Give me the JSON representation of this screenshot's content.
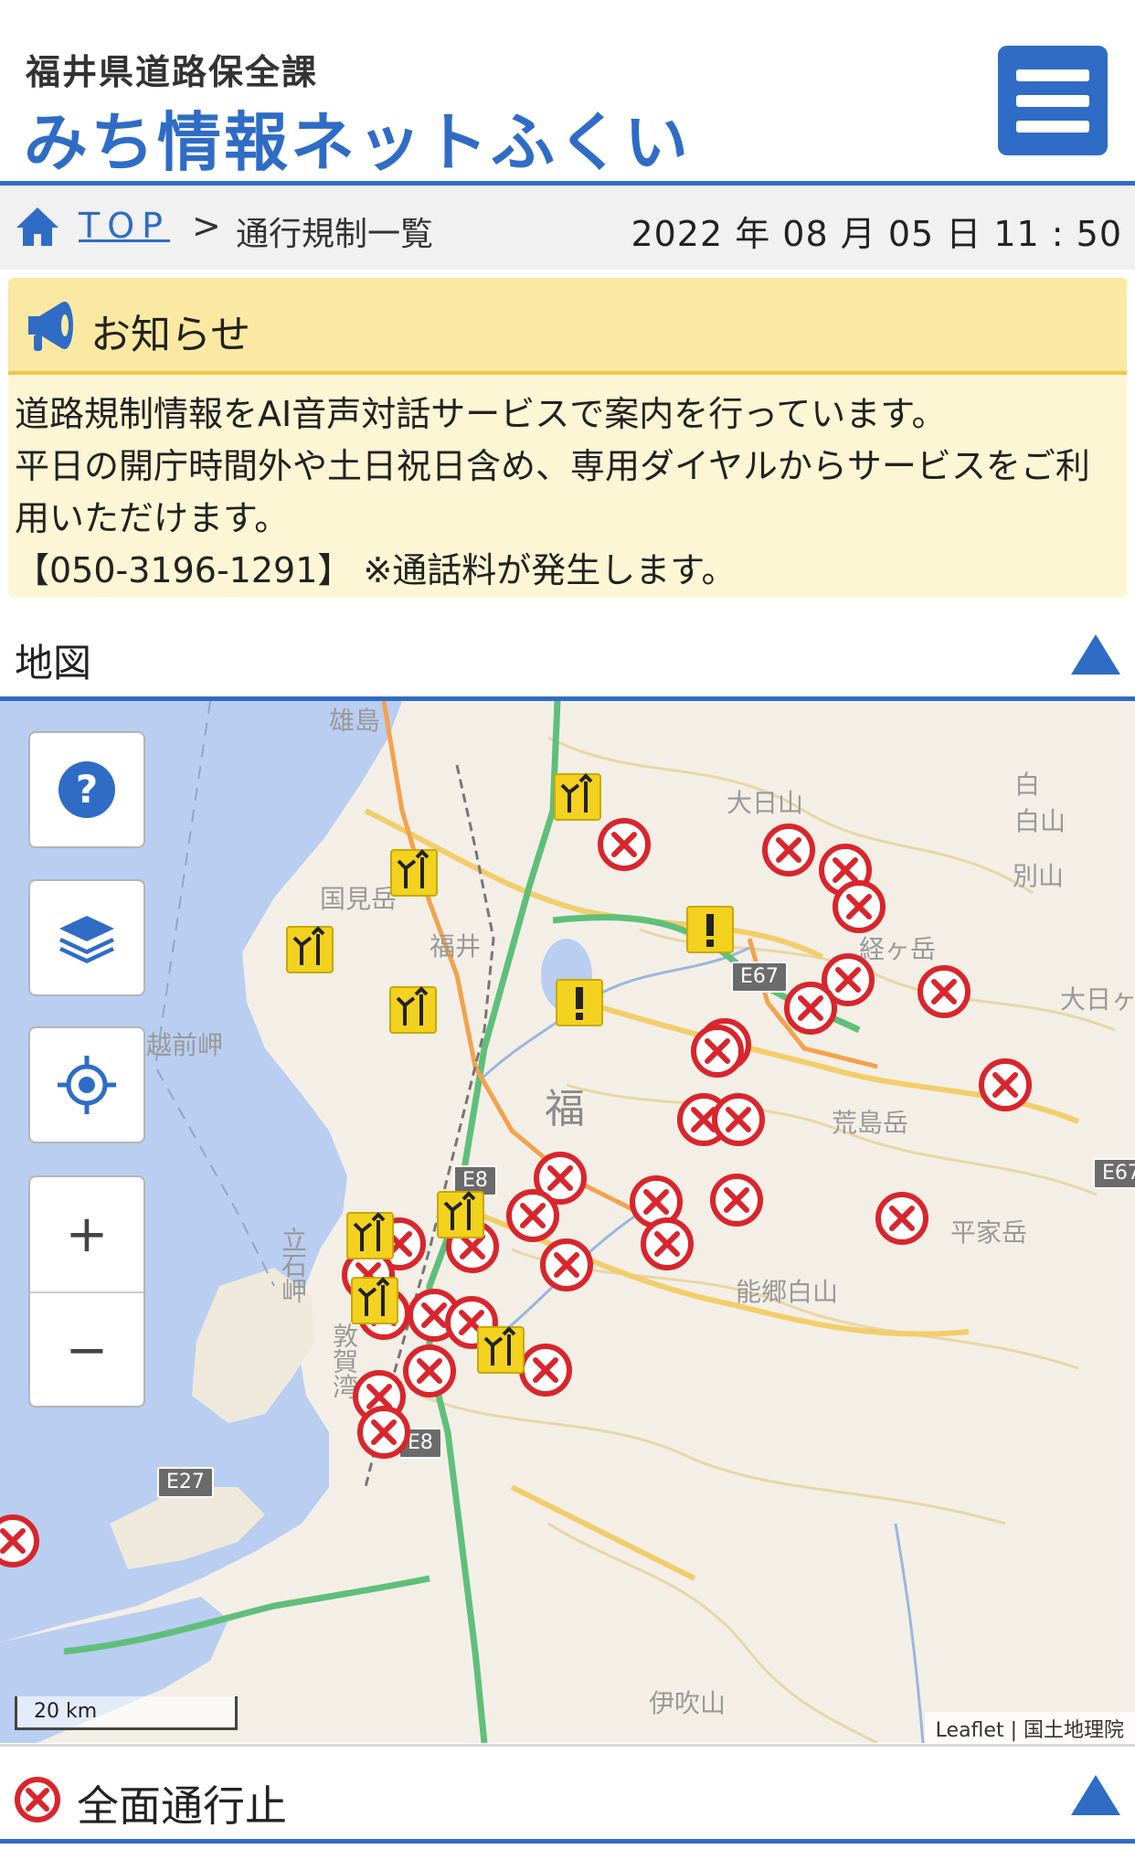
{
  "header": {
    "org_name": "福井県道路保全課",
    "site_name": "みち情報ネットふくい",
    "menu_icon": "hamburger-menu-icon",
    "accent_color": "#2f6cc6"
  },
  "breadcrumb": {
    "home_icon": "home-icon",
    "top_label": "TOP",
    "separator": ">",
    "current": "通行規制一覧",
    "datetime": "2022 年 08 月 05 日 11 : 50"
  },
  "notice": {
    "icon": "megaphone-icon",
    "title": "お知らせ",
    "lines": [
      "道路規制情報をAI音声対話サービスで案内を行っています。",
      "平日の開庁時間外や土日祝日含め、専用ダイヤルからサービスをご利",
      "用いただけます。",
      "【050-3196-1291】 ※通話料が発生します。"
    ]
  },
  "map_section": {
    "title": "地図",
    "collapse_icon": "triangle-up-icon",
    "controls": {
      "help": "help-icon",
      "layers": "layers-icon",
      "locate": "locate-icon",
      "zoom_in": "+",
      "zoom_out": "−"
    },
    "scale_label": "20 km",
    "attribution_leaflet": "Leaflet",
    "attribution_sep": " | ",
    "attribution_gsi": "国土地理院",
    "road_labels": [
      "E67",
      "E67",
      "E8",
      "E8",
      "E27"
    ],
    "place_labels": [
      "越前岬",
      "福井",
      "大日山",
      "白山",
      "別山",
      "経ヶ岳",
      "荒島岳",
      "平家岳",
      "能郷白山",
      "大日ヶ",
      "福",
      "白",
      "立石岬",
      "敦賀湾",
      "国見岳",
      "雄島",
      "伊吹山"
    ]
  },
  "legend": {
    "icon": "road-closed-icon",
    "label": "全面通行止",
    "collapse_icon": "triangle-up-icon"
  },
  "markers": {
    "closed_color": "#d9252c",
    "lane_color": "#f3d21f",
    "warn_color": "#f3d21f"
  }
}
